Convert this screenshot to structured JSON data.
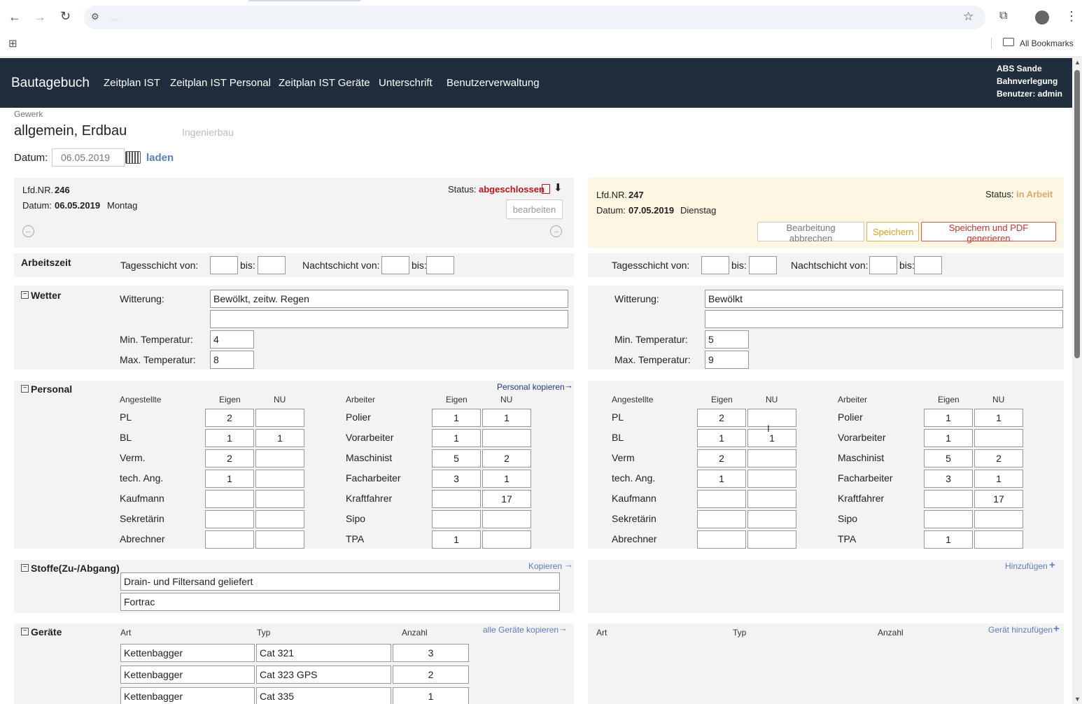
{
  "browser": {
    "url": "...",
    "bookmarks_label": "All Bookmarks"
  },
  "nav": {
    "brand": "Bautagebuch",
    "links": [
      "Zeitplan IST",
      "Zeitplan IST Personal",
      "Zeitplan IST Geräte",
      "Unterschrift",
      "Benutzerverwaltung"
    ],
    "info": [
      "ABS Sande",
      "Bahnverlegung",
      "Benutzer: admin"
    ]
  },
  "gewerk": {
    "label": "Gewerk",
    "active": "allgemein, Erdbau",
    "other": "Ingenierbau"
  },
  "datum": {
    "label": "Datum:",
    "value": "06.05.2019",
    "load": "laden"
  },
  "left": {
    "lfd_label": "Lfd.NR.",
    "lfd": "246",
    "datum_label": "Datum:",
    "datum": "06.05.2019",
    "weekday": "Montag",
    "status_label": "Status:",
    "status": "abgeschlossen",
    "edit_btn": "bearbeiten",
    "arbeitszeit": {
      "title": "Arbeitszeit",
      "tag": "Tagesschicht von:",
      "bis": "bis:",
      "nacht": "Nachtschicht von:"
    },
    "wetter": {
      "title": "Wetter",
      "witterung_label": "Witterung:",
      "witterung": "Bewölkt, zeitw. Regen",
      "witterung2": "",
      "min_label": "Min. Temperatur:",
      "min": "4",
      "max_label": "Max. Temperatur:",
      "max": "8"
    },
    "personal": {
      "title": "Personal",
      "copy": "Personal kopieren",
      "h_ang": "Angestellte",
      "h_eigen": "Eigen",
      "h_nu": "NU",
      "h_arb": "Arbeiter",
      "ang": [
        {
          "l": "PL",
          "e": "2",
          "n": ""
        },
        {
          "l": "BL",
          "e": "1",
          "n": "1"
        },
        {
          "l": "Verm.",
          "e": "2",
          "n": ""
        },
        {
          "l": "tech. Ang.",
          "e": "1",
          "n": ""
        },
        {
          "l": "Kaufmann",
          "e": "",
          "n": ""
        },
        {
          "l": "Sekretärin",
          "e": "",
          "n": ""
        },
        {
          "l": "Abrechner",
          "e": "",
          "n": ""
        }
      ],
      "arb": [
        {
          "l": "Polier",
          "e": "1",
          "n": "1"
        },
        {
          "l": "Vorarbeiter",
          "e": "1",
          "n": ""
        },
        {
          "l": "Maschinist",
          "e": "5",
          "n": "2"
        },
        {
          "l": "Facharbeiter",
          "e": "3",
          "n": "1"
        },
        {
          "l": "Kraftfahrer",
          "e": "",
          "n": "17"
        },
        {
          "l": "Sipo",
          "e": "",
          "n": ""
        },
        {
          "l": "TPA",
          "e": "1",
          "n": ""
        }
      ]
    },
    "stoffe": {
      "title": "Stoffe(Zu-/Abgang)",
      "copy": "Kopieren",
      "items": [
        "Drain- und Filtersand geliefert",
        "Fortrac"
      ]
    },
    "geraete": {
      "title": "Geräte",
      "copy": "alle Geräte kopieren",
      "h_art": "Art",
      "h_typ": "Typ",
      "h_anzahl": "Anzahl",
      "rows": [
        {
          "art": "Kettenbagger",
          "typ": "Cat 321",
          "anz": "3"
        },
        {
          "art": "Kettenbagger",
          "typ": "Cat 323 GPS",
          "anz": "2"
        },
        {
          "art": "Kettenbagger",
          "typ": "Cat 335",
          "anz": "1"
        }
      ]
    }
  },
  "right": {
    "lfd_label": "Lfd.NR.",
    "lfd": "247",
    "datum_label": "Datum:",
    "datum": "07.05.2019",
    "weekday": "Dienstag",
    "status_label": "Status:",
    "status": "in Arbeit",
    "cancel_btn": "Bearbeitung abbrechen",
    "save_btn": "Speichern",
    "savepdf_btn": "Speichern und PDF generieren",
    "arbeitszeit": {
      "tag": "Tagesschicht von:",
      "bis": "bis:",
      "nacht": "Nachtschicht von:"
    },
    "wetter": {
      "witterung_label": "Witterung:",
      "witterung": "Bewölkt",
      "witterung2": "",
      "min_label": "Min. Temperatur:",
      "min": "5",
      "max_label": "Max. Temperatur:",
      "max": "9"
    },
    "personal": {
      "h_ang": "Angestellte",
      "h_eigen": "Eigen",
      "h_nu": "NU",
      "h_arb": "Arbeiter",
      "ang": [
        {
          "l": "PL",
          "e": "2",
          "n": ""
        },
        {
          "l": "BL",
          "e": "1",
          "n": "1"
        },
        {
          "l": "Verm",
          "e": "2",
          "n": ""
        },
        {
          "l": "tech. Ang.",
          "e": "1",
          "n": ""
        },
        {
          "l": "Kaufmann",
          "e": "",
          "n": ""
        },
        {
          "l": "Sekretärin",
          "e": "",
          "n": ""
        },
        {
          "l": "Abrechner",
          "e": "",
          "n": ""
        }
      ],
      "arb": [
        {
          "l": "Polier",
          "e": "1",
          "n": "1"
        },
        {
          "l": "Vorarbeiter",
          "e": "1",
          "n": ""
        },
        {
          "l": "Maschinist",
          "e": "5",
          "n": "2"
        },
        {
          "l": "Facharbeiter",
          "e": "3",
          "n": "1"
        },
        {
          "l": "Kraftfahrer",
          "e": "",
          "n": "17"
        },
        {
          "l": "Sipo",
          "e": "",
          "n": ""
        },
        {
          "l": "TPA",
          "e": "1",
          "n": ""
        }
      ]
    },
    "stoffe": {
      "add": "Hinzufügen"
    },
    "geraete": {
      "add": "Gerät hinzufügen",
      "h_art": "Art",
      "h_typ": "Typ",
      "h_anzahl": "Anzahl"
    }
  }
}
